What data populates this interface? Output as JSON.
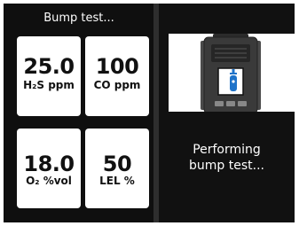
{
  "header": {
    "title": "Bump test..."
  },
  "gas_tiles": [
    {
      "value": "25.0",
      "unit": "H₂S ppm"
    },
    {
      "value": "100",
      "unit": "CO ppm"
    },
    {
      "value": "18.0",
      "unit": "O₂ %vol"
    },
    {
      "value": "50",
      "unit": "LEL %"
    }
  ],
  "status": {
    "line1": "Performing",
    "line2": "bump test..."
  },
  "icons": {
    "device": "gas-detector-icon",
    "cylinder": "gas-cylinder-icon"
  },
  "colors": {
    "background": "#0f0f0f",
    "tile": "#ffffff",
    "device_body": "#3a3a3a",
    "cylinder": "#1f73c9"
  }
}
